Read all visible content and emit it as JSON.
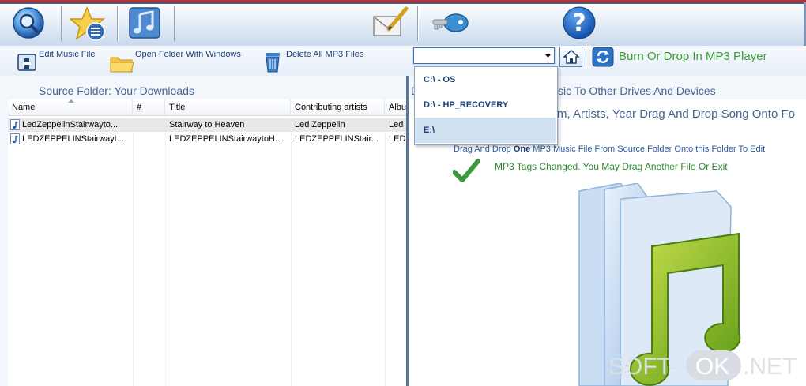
{
  "top_toolbar": {
    "icons": [
      "search-globe-icon",
      "star-list-icon",
      "music-note-icon",
      "envelope-pen-icon",
      "key-icon",
      "help-icon"
    ],
    "help_glyph": "?"
  },
  "toolbar2": {
    "edit_label": "Edit Music File",
    "open_folder_label": "Open Folder With Windows",
    "delete_label": "Delete All MP3 Files",
    "burn_label": "Burn Or Drop In MP3 Player",
    "drive_select_value": ""
  },
  "headings": {
    "source_folder": "Source Folder: Your Downloads",
    "right_heading_left": "D",
    "right_heading_right": "sic To Other Drives And Devices"
  },
  "file_list": {
    "columns": [
      "Name",
      "#",
      "Title",
      "Contributing artists",
      "Albu"
    ],
    "rows": [
      {
        "name": "LedZeppelinStairwayto...",
        "num": "",
        "title": "Stairway to Heaven",
        "artist": "Led Zeppelin",
        "album": "Led"
      },
      {
        "name": "LEDZEPPELINStairwayt...",
        "num": "",
        "title": "LEDZEPPELINStairwaytoH...",
        "artist": "LEDZEPPELINStair...",
        "album": "LED"
      }
    ]
  },
  "drive_dropdown": {
    "options": [
      "C:\\ - OS",
      "D:\\ - HP_RECOVERY",
      "E:\\"
    ],
    "highlighted_index": 2
  },
  "right_panel": {
    "instruction_partial": "m, Artists, Year Drag And Drop Song Onto Fo",
    "drag_pre": "Drag And Drop ",
    "drag_bold": "One",
    "drag_post": " MP3 Music File From Source Folder Onto this Folder To Edit",
    "status": "MP3 Tags Changed. You May Drag Another File Or Exit"
  },
  "watermark": {
    "left": "SOFT-",
    "middle": "OK",
    "right": ".NET"
  },
  "colors": {
    "accent_blue": "#1c3e73",
    "heading_blue": "#45638e",
    "burn_green": "#3f9c35",
    "status_green": "#2d8a2d"
  }
}
